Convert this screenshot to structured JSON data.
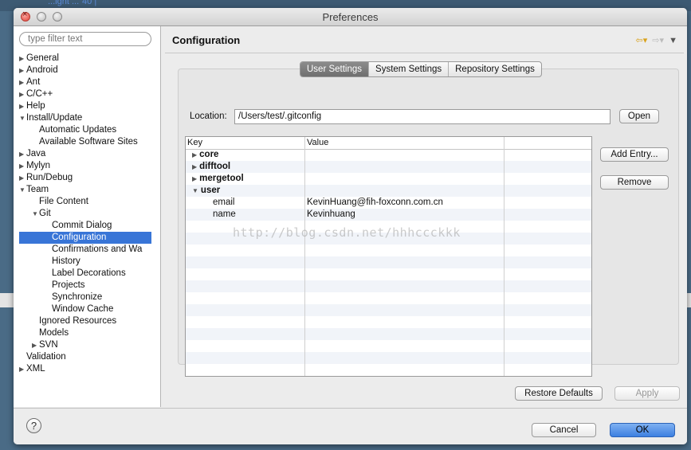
{
  "window": {
    "title": "Preferences"
  },
  "background": {
    "fragment": "...ight ...\"40 |\""
  },
  "filter": {
    "placeholder": "type filter text"
  },
  "tree": [
    {
      "label": "General",
      "level": 0,
      "toggle": "closed"
    },
    {
      "label": "Android",
      "level": 0,
      "toggle": "closed"
    },
    {
      "label": "Ant",
      "level": 0,
      "toggle": "closed"
    },
    {
      "label": "C/C++",
      "level": 0,
      "toggle": "closed"
    },
    {
      "label": "Help",
      "level": 0,
      "toggle": "closed"
    },
    {
      "label": "Install/Update",
      "level": 0,
      "toggle": "open"
    },
    {
      "label": "Automatic Updates",
      "level": 1,
      "toggle": "none"
    },
    {
      "label": "Available Software Sites",
      "level": 1,
      "toggle": "none"
    },
    {
      "label": "Java",
      "level": 0,
      "toggle": "closed"
    },
    {
      "label": "Mylyn",
      "level": 0,
      "toggle": "closed"
    },
    {
      "label": "Run/Debug",
      "level": 0,
      "toggle": "closed"
    },
    {
      "label": "Team",
      "level": 0,
      "toggle": "open"
    },
    {
      "label": "File Content",
      "level": 1,
      "toggle": "none"
    },
    {
      "label": "Git",
      "level": 1,
      "toggle": "open"
    },
    {
      "label": "Commit Dialog",
      "level": 2,
      "toggle": "none"
    },
    {
      "label": "Configuration",
      "level": 2,
      "toggle": "none",
      "selected": true
    },
    {
      "label": "Confirmations and Wa",
      "level": 2,
      "toggle": "none"
    },
    {
      "label": "History",
      "level": 2,
      "toggle": "none"
    },
    {
      "label": "Label Decorations",
      "level": 2,
      "toggle": "none"
    },
    {
      "label": "Projects",
      "level": 2,
      "toggle": "none"
    },
    {
      "label": "Synchronize",
      "level": 2,
      "toggle": "none"
    },
    {
      "label": "Window Cache",
      "level": 2,
      "toggle": "none"
    },
    {
      "label": "Ignored Resources",
      "level": 1,
      "toggle": "none"
    },
    {
      "label": "Models",
      "level": 1,
      "toggle": "none"
    },
    {
      "label": "SVN",
      "level": 1,
      "toggle": "closed"
    },
    {
      "label": "Validation",
      "level": 0,
      "toggle": "none"
    },
    {
      "label": "XML",
      "level": 0,
      "toggle": "closed"
    }
  ],
  "page": {
    "title": "Configuration"
  },
  "tabs": [
    {
      "label": "User Settings",
      "active": true
    },
    {
      "label": "System Settings",
      "active": false
    },
    {
      "label": "Repository Settings",
      "active": false
    }
  ],
  "location": {
    "label": "Location:",
    "value": "/Users/test/.gitconfig",
    "open_label": "Open"
  },
  "table": {
    "columns": [
      "Key",
      "Value"
    ],
    "rows": [
      {
        "key": "core",
        "value": "",
        "level": 0,
        "toggle": "closed"
      },
      {
        "key": "difftool",
        "value": "",
        "level": 0,
        "toggle": "closed"
      },
      {
        "key": "mergetool",
        "value": "",
        "level": 0,
        "toggle": "closed"
      },
      {
        "key": "user",
        "value": "",
        "level": 0,
        "toggle": "open"
      },
      {
        "key": "email",
        "value": "KevinHuang@fih-foxconn.com.cn",
        "level": 1,
        "toggle": "none"
      },
      {
        "key": "name",
        "value": "Kevinhuang",
        "level": 1,
        "toggle": "none"
      }
    ]
  },
  "buttons": {
    "add_entry": "Add Entry...",
    "remove": "Remove",
    "restore_defaults": "Restore Defaults",
    "apply": "Apply",
    "cancel": "Cancel",
    "ok": "OK"
  },
  "help": {
    "glyph": "?"
  },
  "watermark": "http://blog.csdn.net/hhhccckkk",
  "icons": {
    "back": "arrow-left-icon",
    "forward": "arrow-right-icon",
    "menu": "view-menu-icon"
  }
}
